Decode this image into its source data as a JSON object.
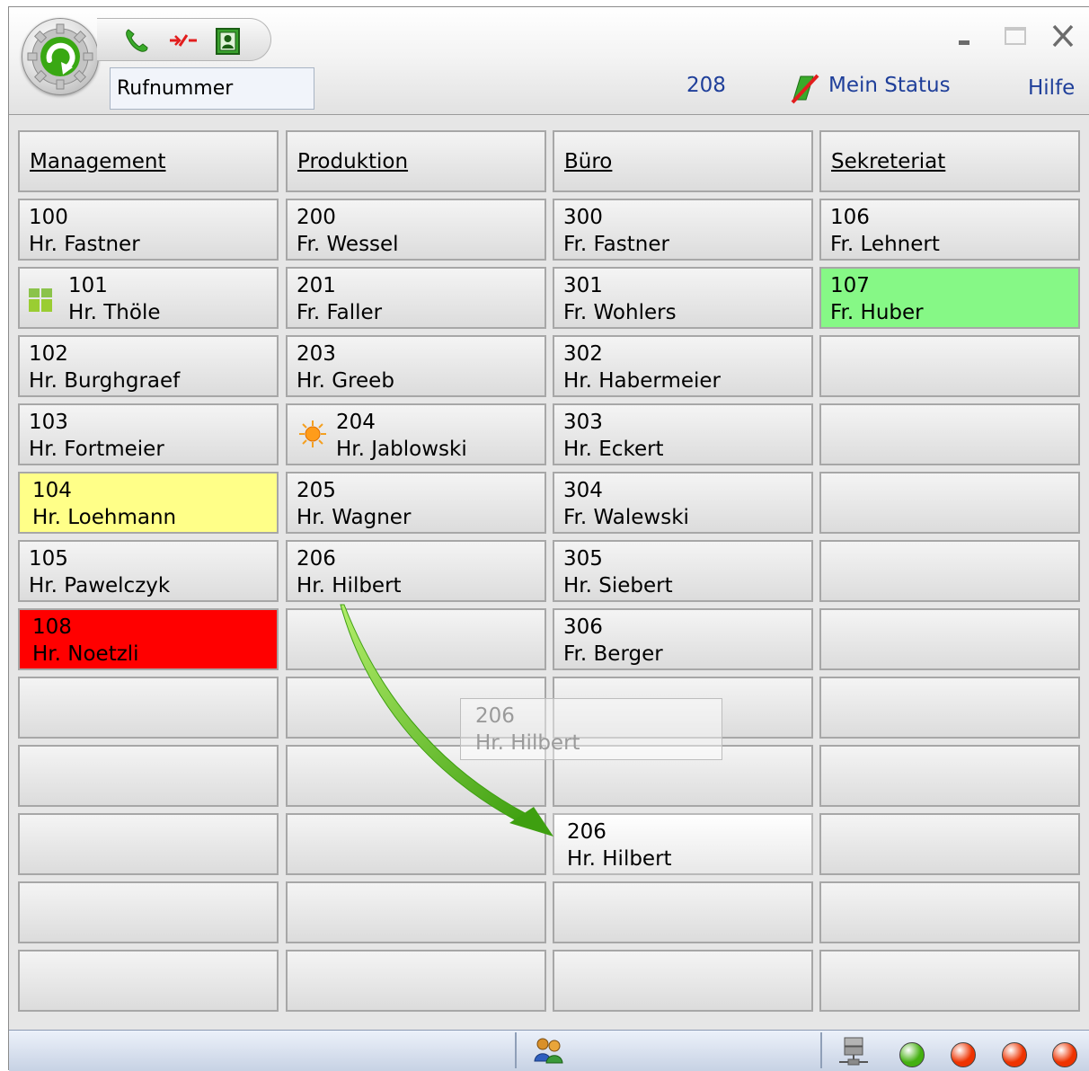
{
  "header": {
    "number_placeholder": "Rufnummer",
    "extension": "208",
    "my_status": "Mein Status",
    "help": "Hilfe"
  },
  "colors": {
    "accent_text": "#1f3f9a",
    "busy": "#ff0000",
    "available": "#86f886",
    "ringing": "#ffff88",
    "drag_arrow": "#5ec418"
  },
  "columns": [
    {
      "title": "Management",
      "entries": [
        {
          "number": "100",
          "name": "Hr. Fastner",
          "state": "normal",
          "icon": ""
        },
        {
          "number": "101",
          "name": "Hr. Thöle",
          "state": "normal",
          "icon": "group-icon"
        },
        {
          "number": "102",
          "name": "Hr. Burghgraef",
          "state": "normal",
          "icon": ""
        },
        {
          "number": "103",
          "name": "Hr. Fortmeier",
          "state": "normal",
          "icon": ""
        },
        {
          "number": "104",
          "name": "Hr. Loehmann",
          "state": "yellow",
          "icon": ""
        },
        {
          "number": "105",
          "name": "Hr. Pawelczyk",
          "state": "normal",
          "icon": ""
        },
        {
          "number": "108",
          "name": "Hr. Noetzli",
          "state": "red",
          "icon": ""
        }
      ]
    },
    {
      "title": "Produktion",
      "entries": [
        {
          "number": "200",
          "name": "Fr. Wessel",
          "state": "normal",
          "icon": ""
        },
        {
          "number": "201",
          "name": "Fr. Faller",
          "state": "normal",
          "icon": ""
        },
        {
          "number": "203",
          "name": "Hr. Greeb",
          "state": "normal",
          "icon": ""
        },
        {
          "number": "204",
          "name": "Hr. Jablowski",
          "state": "normal",
          "icon": "sun-icon"
        },
        {
          "number": "205",
          "name": "Hr. Wagner",
          "state": "normal",
          "icon": ""
        },
        {
          "number": "206",
          "name": "Hr. Hilbert",
          "state": "normal",
          "icon": ""
        }
      ]
    },
    {
      "title": "Büro",
      "entries": [
        {
          "number": "300",
          "name": "Fr. Fastner",
          "state": "normal",
          "icon": ""
        },
        {
          "number": "301",
          "name": "Fr. Wohlers",
          "state": "normal",
          "icon": ""
        },
        {
          "number": "302",
          "name": "Hr. Habermeier",
          "state": "normal",
          "icon": ""
        },
        {
          "number": "303",
          "name": "Hr. Eckert",
          "state": "normal",
          "icon": ""
        },
        {
          "number": "304",
          "name": "Fr. Walewski",
          "state": "normal",
          "icon": ""
        },
        {
          "number": "305",
          "name": "Hr. Siebert",
          "state": "normal",
          "icon": ""
        },
        {
          "number": "306",
          "name": "Fr. Berger",
          "state": "normal",
          "icon": ""
        },
        null,
        null,
        {
          "number": "206",
          "name": "Hr. Hilbert",
          "state": "drop",
          "icon": ""
        }
      ]
    },
    {
      "title": "Sekreteriat",
      "entries": [
        {
          "number": "106",
          "name": "Fr. Lehnert",
          "state": "normal",
          "icon": ""
        },
        {
          "number": "107",
          "name": "Fr. Huber",
          "state": "green",
          "icon": ""
        }
      ]
    }
  ],
  "drag_ghost": {
    "number": "206",
    "name": "Hr. Hilbert"
  },
  "statusbar": {
    "leds": [
      "#44b010",
      "#ee3300",
      "#ee3300",
      "#ee3300"
    ]
  }
}
